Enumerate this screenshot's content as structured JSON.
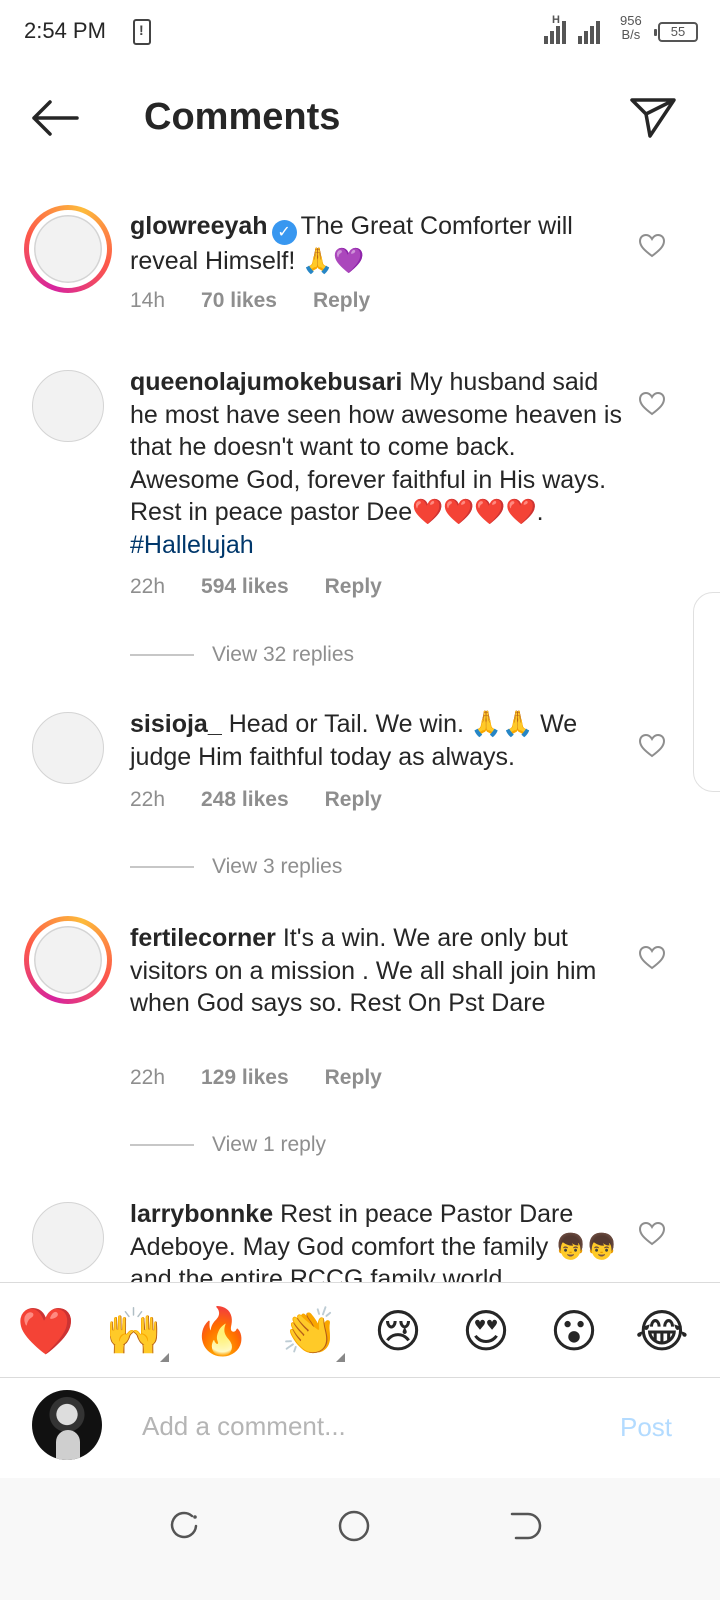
{
  "status_bar": {
    "time": "2:54 PM",
    "network_type": "H",
    "net_speed_value": "956",
    "net_speed_unit": "B/s",
    "battery": "55"
  },
  "header": {
    "title": "Comments",
    "back_icon": "arrow-left-icon",
    "share_icon": "paper-plane-icon"
  },
  "comments": [
    {
      "username": "glowreeyah",
      "verified": true,
      "text": "The Great Comforter will reveal Himself! 🙏💜",
      "time": "14h",
      "likes": "70 likes",
      "reply": "Reply",
      "story_ring": true
    },
    {
      "username": "queenolajumokebusari",
      "verified": false,
      "text": "My husband said he most have seen how awesome heaven is that he doesn't want to come back. Awesome God, forever faithful in His ways. Rest in peace pastor Dee❤️❤️❤️❤️. ",
      "hashtag": "#Hallelujah",
      "time": "22h",
      "likes": "594 likes",
      "reply": "Reply",
      "view_replies": "View 32 replies",
      "story_ring": false
    },
    {
      "username": "sisioja_",
      "verified": false,
      "text": "Head or Tail. We win. 🙏🙏 We judge Him faithful today as always.",
      "time": "22h",
      "likes": "248 likes",
      "reply": "Reply",
      "view_replies": "View 3 replies",
      "story_ring": false
    },
    {
      "username": "fertilecorner",
      "verified": false,
      "text": "It's a win. We are only but visitors on a mission . We all shall join him when God says so. Rest On Pst Dare",
      "time": "22h",
      "likes": "129 likes",
      "reply": "Reply",
      "view_replies": "View 1 reply",
      "story_ring": true
    },
    {
      "username": "larrybonnke",
      "verified": false,
      "text": "Rest in peace Pastor Dare Adeboye. May God comfort the family 👦👦 and the entire RCCG family world",
      "story_ring": false
    }
  ],
  "emoji_bar": [
    "❤️",
    "🙌",
    "🔥",
    "👏",
    "😢",
    "😍",
    "😮",
    "😂"
  ],
  "input": {
    "placeholder": "Add a comment...",
    "post_label": "Post"
  },
  "nav": {
    "icons": [
      "recent-apps-icon",
      "home-icon",
      "back-nav-icon"
    ]
  },
  "colors": {
    "link": "#00376b",
    "verified": "#3897f0",
    "post_disabled": "#b3dbff",
    "secondary_text": "#8e8e8e"
  }
}
